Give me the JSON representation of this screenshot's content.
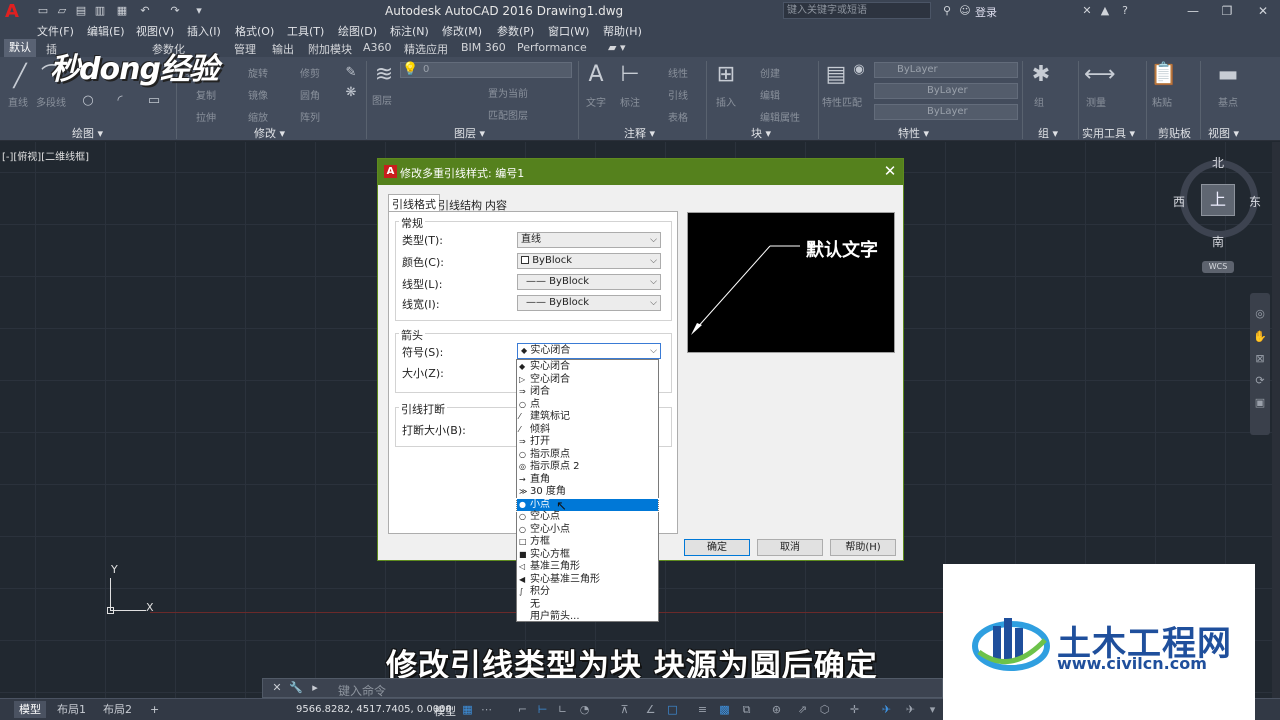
{
  "window": {
    "title": "Autodesk AutoCAD 2016    Drawing1.dwg",
    "search_placeholder": "键入关键字或短语",
    "login": "登录",
    "app_logo": "A"
  },
  "menu": [
    "文件(F)",
    "编辑(E)",
    "视图(V)",
    "插入(I)",
    "格式(O)",
    "工具(T)",
    "绘图(D)",
    "标注(N)",
    "修改(M)",
    "参数(P)",
    "窗口(W)",
    "帮助(H)"
  ],
  "ribbon_tabs": [
    "默认",
    "插",
    "参数化",
    "管理",
    "输出",
    "附加模块",
    "A360",
    "精选应用",
    "BIM 360",
    "Performance"
  ],
  "ribbon_panels": [
    "绘图 ▾",
    "修改 ▾",
    "图层 ▾",
    "注释 ▾",
    "块 ▾",
    "特性 ▾",
    "组 ▾",
    "实用工具 ▾",
    "剪贴板",
    "视图 ▾"
  ],
  "ribbon_faded": {
    "line": "直线",
    "polyline": "多段线",
    "move": "移动",
    "rotate": "旋转",
    "trim": "修剪",
    "copy": "复制",
    "mirror": "镜像",
    "fillet": "圆角",
    "stretch": "拉伸",
    "scale": "缩放",
    "array": "阵列",
    "text": "文字",
    "dimension": "标注",
    "linear": "线性",
    "leader": "引线",
    "table": "表格",
    "insert": "插入",
    "create": "创建",
    "edit": "编辑",
    "edit_attr": "编辑属性",
    "match": "特性匹配",
    "bylayer": "ByLayer",
    "group": "组",
    "measure": "测量",
    "paste": "粘贴",
    "base": "基点",
    "layer_state": "置为当前",
    "match_layer": "匹配图层",
    "layer_zero": "0"
  },
  "brand_watermark": "秒dong经验",
  "viewport_label": "[-][俯视][二维线框]",
  "viewcube": {
    "face": "上",
    "north": "北",
    "south": "南",
    "east": "东",
    "west": "西",
    "wcs": "WCS"
  },
  "ucs": {
    "x": "X",
    "y": "Y"
  },
  "dialog": {
    "title": "修改多重引线样式: 编号1",
    "close": "✕",
    "tabs": [
      "引线格式",
      "引线结构",
      "内容"
    ],
    "general": {
      "title": "常规",
      "type_label": "类型(T):",
      "type_value": "直线",
      "color_label": "颜色(C):",
      "color_value": "ByBlock",
      "linetype_label": "线型(L):",
      "linetype_value": "—— ByBlock",
      "lineweight_label": "线宽(I):",
      "lineweight_value": "—— ByBlock"
    },
    "arrowhead": {
      "title": "箭头",
      "symbol_label": "符号(S):",
      "symbol_value": "实心闭合",
      "size_label": "大小(Z):"
    },
    "landing": {
      "title": "引线打断",
      "break_label": "打断大小(B):"
    },
    "preview_text": "默认文字",
    "buttons": {
      "ok": "确定",
      "cancel": "取消",
      "help": "帮助(H)"
    }
  },
  "arrow_options": [
    {
      "label": "实心闭合",
      "icon": "◆"
    },
    {
      "label": "空心闭合",
      "icon": "▷"
    },
    {
      "label": "闭合",
      "icon": "⇒"
    },
    {
      "label": "点",
      "icon": "○"
    },
    {
      "label": "建筑标记",
      "icon": "⁄"
    },
    {
      "label": "倾斜",
      "icon": "⁄"
    },
    {
      "label": "打开",
      "icon": "⇒"
    },
    {
      "label": "指示原点",
      "icon": "○"
    },
    {
      "label": "指示原点 2",
      "icon": "◎"
    },
    {
      "label": "直角",
      "icon": "→"
    },
    {
      "label": "30 度角",
      "icon": "≫"
    },
    {
      "label": "小点",
      "icon": "●"
    },
    {
      "label": "空心点",
      "icon": "○"
    },
    {
      "label": "空心小点",
      "icon": "○"
    },
    {
      "label": "方框",
      "icon": "□"
    },
    {
      "label": "实心方框",
      "icon": "■"
    },
    {
      "label": "基准三角形",
      "icon": "◁"
    },
    {
      "label": "实心基准三角形",
      "icon": "◀"
    },
    {
      "label": "积分",
      "icon": "∫"
    },
    {
      "label": "无",
      "icon": ""
    },
    {
      "label": "用户箭头...",
      "icon": ""
    }
  ],
  "selected_arrow_index": 11,
  "subtitle": "修改引线类型为块 块源为圆后确定",
  "command": {
    "placeholder": "键入命令"
  },
  "status": {
    "layout_tabs": [
      "模型",
      "布局1",
      "布局2"
    ],
    "add_tab": "+",
    "coords": "9566.8282, 4517.7405, 0.0000",
    "model": "模型"
  },
  "brand": {
    "name": "土木工程网",
    "url": "www.civilcn.com"
  },
  "colors": {
    "dialog_title": "#55811d",
    "selection": "#0078d7",
    "brand": "#1f4f9c"
  }
}
